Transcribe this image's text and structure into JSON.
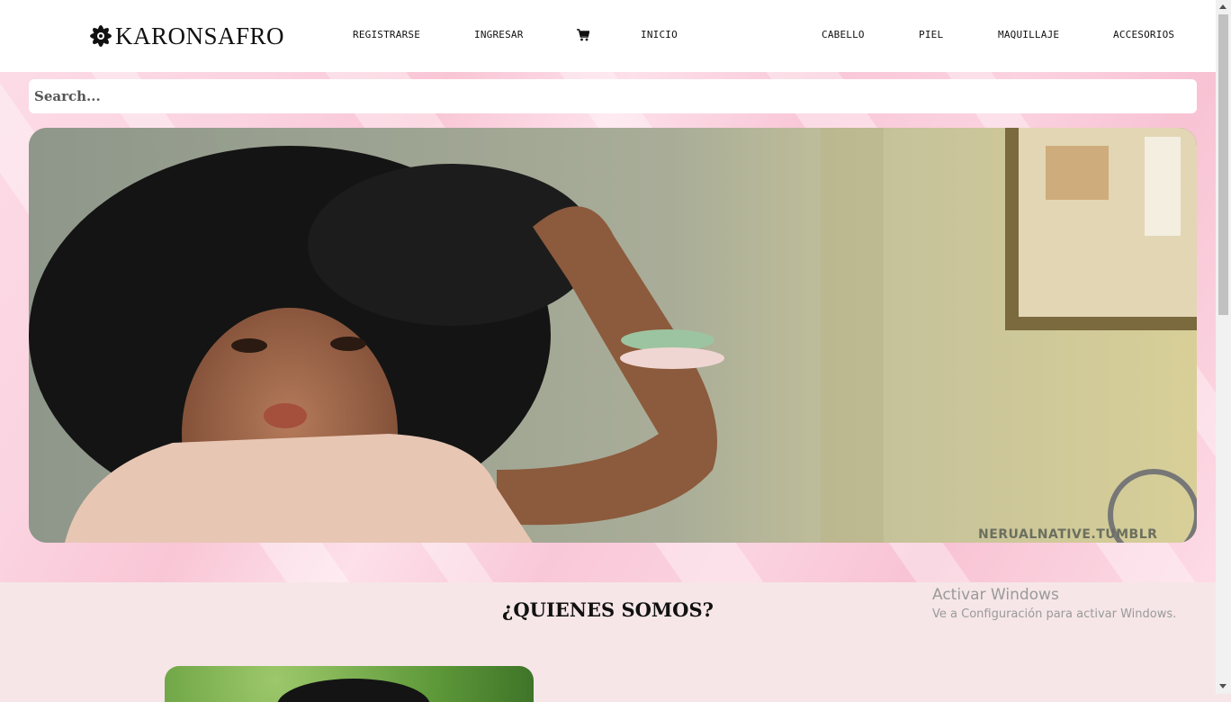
{
  "brand": {
    "name": "KARONSAFRO",
    "icon": "flower-icon"
  },
  "nav": {
    "left": [
      {
        "label": "REGISTRARSE"
      },
      {
        "label": "INGRESAR"
      }
    ],
    "cart_icon": "shopping-cart-icon",
    "inicio": "INICIO",
    "right": [
      {
        "label": "CABELLO"
      },
      {
        "label": "PIEL"
      },
      {
        "label": "MAQUILLAJE"
      },
      {
        "label": "ACCESORIOS"
      }
    ]
  },
  "search": {
    "placeholder": "Search..."
  },
  "banner": {
    "watermark": "NERUALNATIVE.TUMBLR"
  },
  "about": {
    "title": "¿QUIENES SOMOS?"
  },
  "windows_activation": {
    "title": "Activar Windows",
    "subtitle": "Ve a Configuración para activar Windows."
  },
  "colors": {
    "header_bg": "#ffffff",
    "hero_pink": "#f9c6d6",
    "section_bg": "#f6e6e8"
  }
}
